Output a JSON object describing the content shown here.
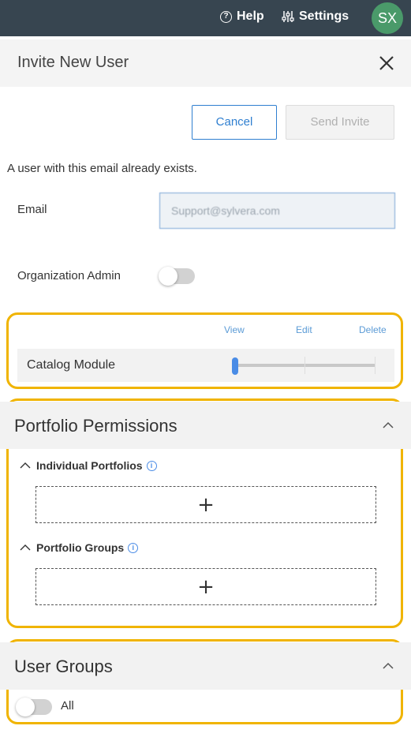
{
  "topbar": {
    "help_label": "Help",
    "settings_label": "Settings",
    "avatar_initials": "SX"
  },
  "header": {
    "title": "Invite New User",
    "close_icon": "close-icon"
  },
  "actions": {
    "cancel_label": "Cancel",
    "send_label": "Send Invite"
  },
  "message": "A user with this email already exists.",
  "form": {
    "email_label": "Email",
    "email_value": "Support@sylvera.com",
    "org_admin_label": "Organization Admin",
    "org_admin_on": false
  },
  "catalog": {
    "columns": [
      "View",
      "Edit",
      "Delete"
    ],
    "module_name": "Catalog Module",
    "access_level": "View"
  },
  "portfolio": {
    "title": "Portfolio Permissions",
    "individual_label": "Individual Portfolios",
    "groups_label": "Portfolio Groups",
    "add_symbol": "+"
  },
  "user_groups": {
    "title": "User Groups",
    "all_label": "All",
    "all_on": false
  },
  "colors": {
    "topbar": "#374550",
    "accent": "#2f7fd0",
    "highlight": "#f0b400",
    "avatar": "#4a9a6a"
  }
}
